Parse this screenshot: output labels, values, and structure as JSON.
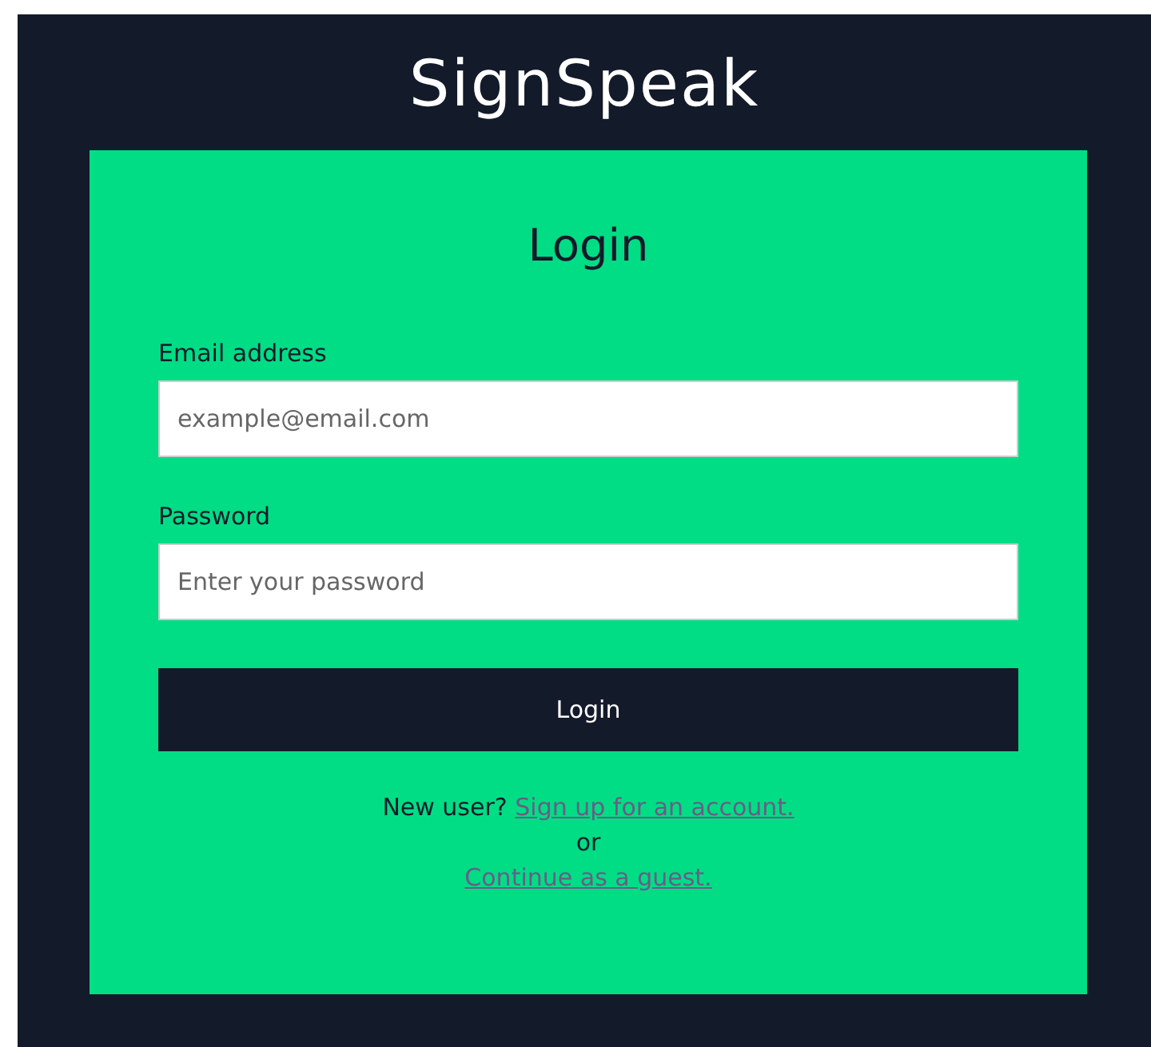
{
  "app_title": "SignSpeak",
  "form": {
    "heading": "Login",
    "fields": [
      {
        "label": "Email address",
        "placeholder": "example@email.com"
      },
      {
        "label": "Password",
        "placeholder": "Enter your password"
      }
    ],
    "submit": "Login",
    "signup_prompt": "New user?",
    "signup_link": "Sign up for an account.",
    "separator": "or",
    "guest_link": "Continue as a guest."
  }
}
